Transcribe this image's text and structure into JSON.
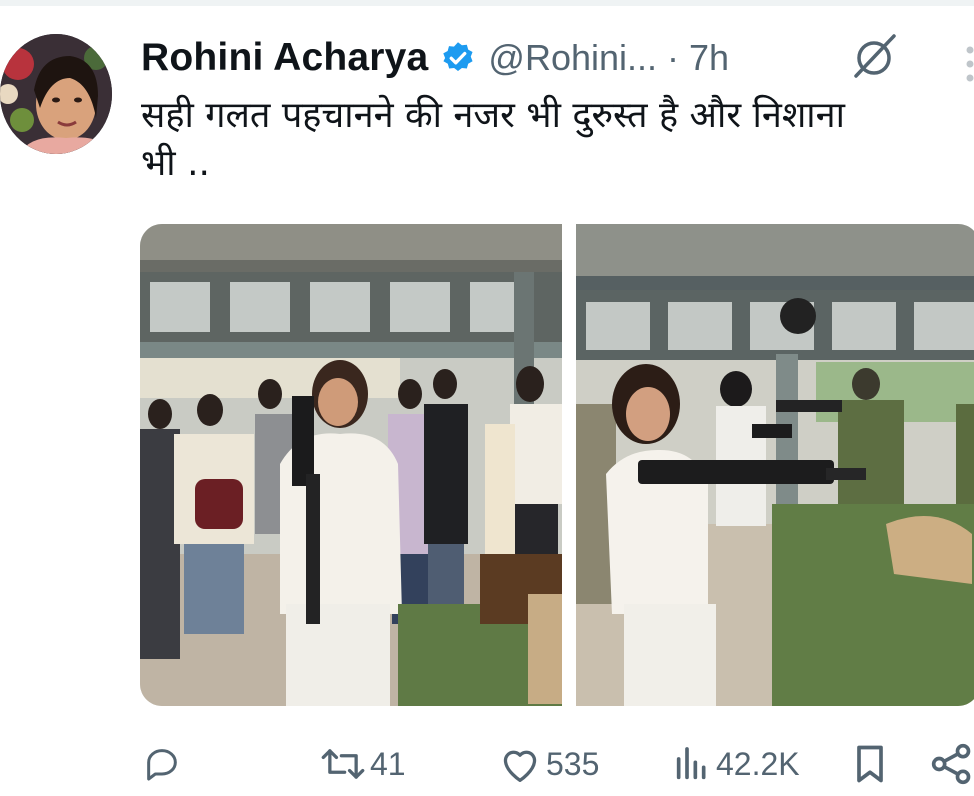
{
  "tweet": {
    "author_name": "Rohini Acharya",
    "handle": "@Rohini...",
    "separator": "·",
    "time": "7h",
    "text_line1": "सही गलत पहचानने की नजर भी दुरुस्त है और निशाना",
    "text_line2": "भी .."
  },
  "stats": {
    "replies": "",
    "retweets": "41",
    "likes": "535",
    "views": "42.2K"
  },
  "icons": {
    "verified": "verified-badge-icon",
    "grok": "grok-icon",
    "more": "more-vertical-icon",
    "reply": "reply-icon",
    "retweet": "retweet-icon",
    "like": "heart-icon",
    "views": "views-chart-icon",
    "bookmark": "bookmark-icon",
    "share": "share-icon"
  },
  "colors": {
    "verified_blue": "#1d9bf0",
    "secondary_text": "#536471",
    "primary_text": "#0f1419"
  }
}
